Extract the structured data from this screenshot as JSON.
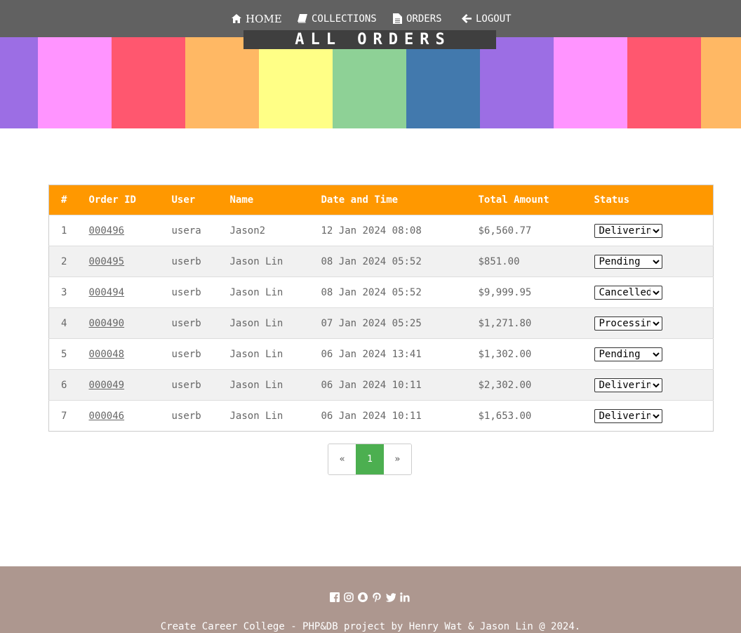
{
  "nav": {
    "home": "HOME",
    "collections": "COLLECTIONS",
    "orders": "ORDERS",
    "logout": "LOGOUT"
  },
  "banner": {
    "title": "ALL ORDERS",
    "stripe_colors": [
      "#9c6ee4",
      "#ff94ff",
      "#ff576f",
      "#ffb864",
      "#ffff86",
      "#8ed196",
      "#4279ad",
      "#9c6ee4",
      "#ff94ff",
      "#ff576f",
      "#ffb864"
    ]
  },
  "table": {
    "headers": [
      "#",
      "Order ID",
      "User",
      "Name",
      "Date and Time",
      "Total Amount",
      "Status"
    ],
    "rows": [
      {
        "num": "1",
        "order_id": "000496",
        "user": "usera",
        "name": "Jason2",
        "datetime": "12 Jan 2024 08:08",
        "total": "$6,560.77",
        "status": "Delivering"
      },
      {
        "num": "2",
        "order_id": "000495",
        "user": "userb",
        "name": "Jason Lin",
        "datetime": "08 Jan 2024 05:52",
        "total": "$851.00",
        "status": "Pending"
      },
      {
        "num": "3",
        "order_id": "000494",
        "user": "userb",
        "name": "Jason Lin",
        "datetime": "08 Jan 2024 05:52",
        "total": "$9,999.95",
        "status": "Cancelled"
      },
      {
        "num": "4",
        "order_id": "000490",
        "user": "userb",
        "name": "Jason Lin",
        "datetime": "07 Jan 2024 05:25",
        "total": "$1,271.80",
        "status": "Processing"
      },
      {
        "num": "5",
        "order_id": "000048",
        "user": "userb",
        "name": "Jason Lin",
        "datetime": "06 Jan 2024 13:41",
        "total": "$1,302.00",
        "status": "Pending"
      },
      {
        "num": "6",
        "order_id": "000049",
        "user": "userb",
        "name": "Jason Lin",
        "datetime": "06 Jan 2024 10:11",
        "total": "$2,302.00",
        "status": "Delivering"
      },
      {
        "num": "7",
        "order_id": "000046",
        "user": "userb",
        "name": "Jason Lin",
        "datetime": "06 Jan 2024 10:11",
        "total": "$1,653.00",
        "status": "Delivering"
      }
    ]
  },
  "pagination": {
    "prev": "«",
    "current": "1",
    "next": "»"
  },
  "footer": {
    "social_icons": [
      "facebook-icon",
      "instagram-icon",
      "snapchat-icon",
      "pinterest-icon",
      "twitter-icon",
      "linkedin-icon"
    ],
    "text": "Create Career College - PHP&DB project by Henry Wat & Jason Lin @ 2024."
  },
  "colors": {
    "nav_bg": "#616161",
    "table_header": "#ff9800",
    "pagination_active": "#4caf50",
    "footer_bg": "#ad978f"
  }
}
